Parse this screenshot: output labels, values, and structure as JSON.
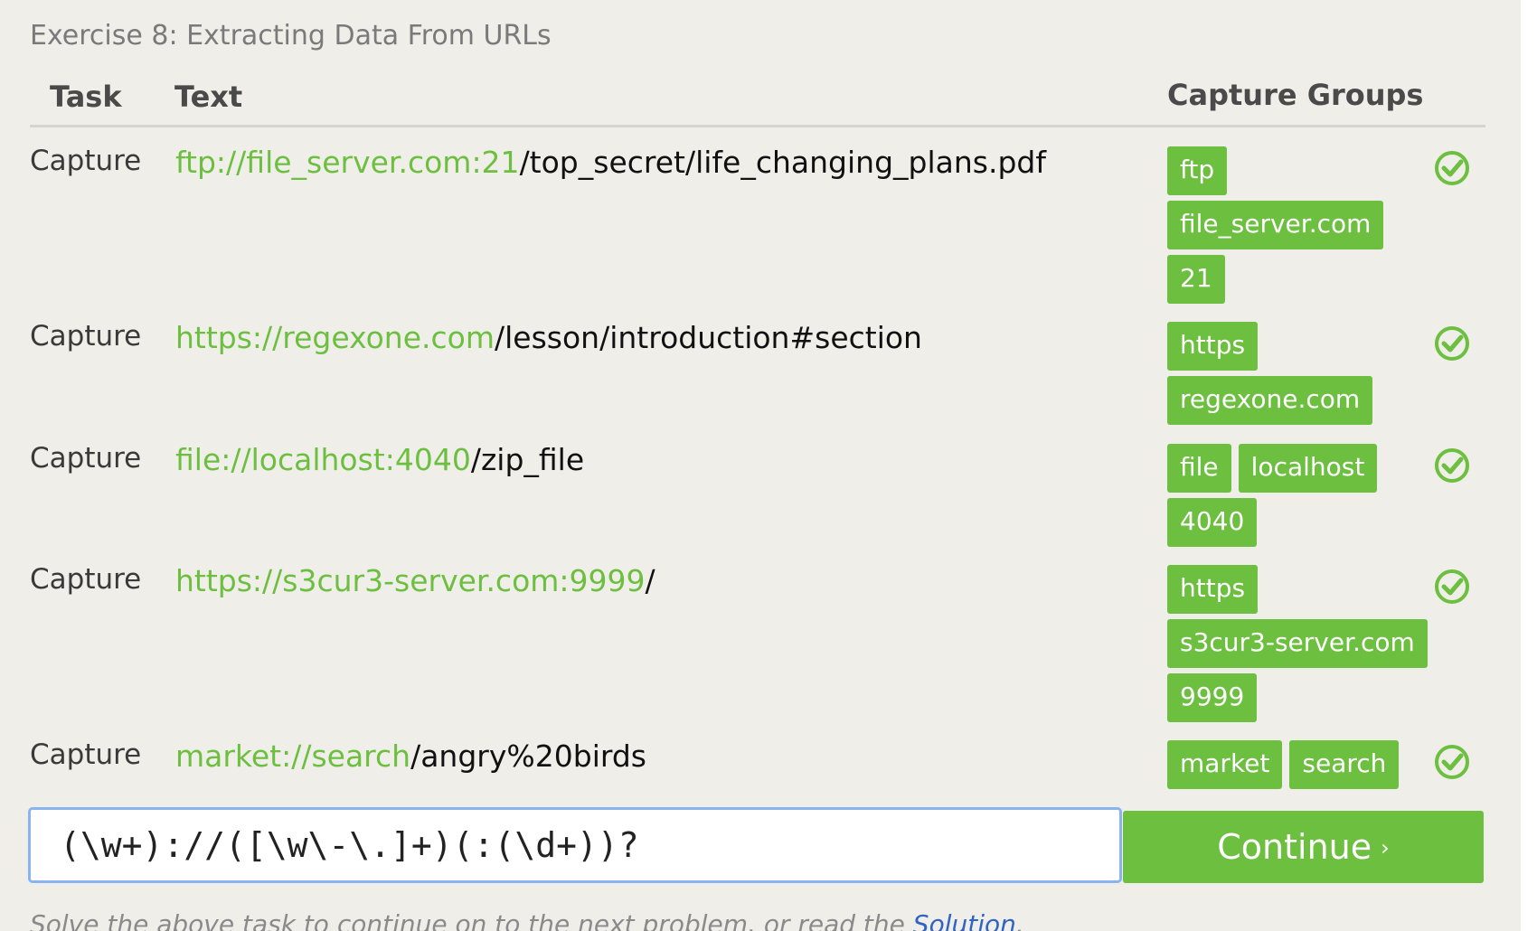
{
  "exercise_title": "Exercise 8: Extracting Data From URLs",
  "columns": {
    "task": "Task",
    "text": "Text",
    "capture_groups": "Capture Groups"
  },
  "rows": [
    {
      "task": "Capture",
      "match": "ftp://file_server.com:21",
      "rest": "/top_secret/life_changing_plans.pdf",
      "groups": [
        "ftp",
        "file_server.com",
        "21"
      ],
      "status": "success"
    },
    {
      "task": "Capture",
      "match": "https://regexone.com",
      "rest": "/lesson/introduction#section",
      "groups": [
        "https",
        "regexone.com"
      ],
      "status": "success"
    },
    {
      "task": "Capture",
      "match": "file://localhost:4040",
      "rest": "/zip_file",
      "groups": [
        "file",
        "localhost",
        "4040"
      ],
      "status": "success"
    },
    {
      "task": "Capture",
      "match": "https://s3cur3-server.com:9999",
      "rest": "/",
      "groups": [
        "https",
        "s3cur3-server.com",
        "9999"
      ],
      "status": "success"
    },
    {
      "task": "Capture",
      "match": "market://search",
      "rest": "/angry%20birds",
      "groups": [
        "market",
        "search"
      ],
      "status": "success"
    }
  ],
  "regex_input": {
    "value": "(\\w+)://([\\w\\-\\.]+)(:(\\d+))?"
  },
  "continue_button": {
    "label": "Continue",
    "chevron": "›"
  },
  "footer": {
    "text": "Solve the above task to continue on to the next problem, or read the ",
    "link": "Solution",
    "end": "."
  },
  "colors": {
    "accent": "#6cbf3f",
    "background": "#f0eee9",
    "link": "#2f64c4",
    "focus": "#8ab4f0"
  },
  "icons": {
    "status": "check-circle-icon"
  }
}
